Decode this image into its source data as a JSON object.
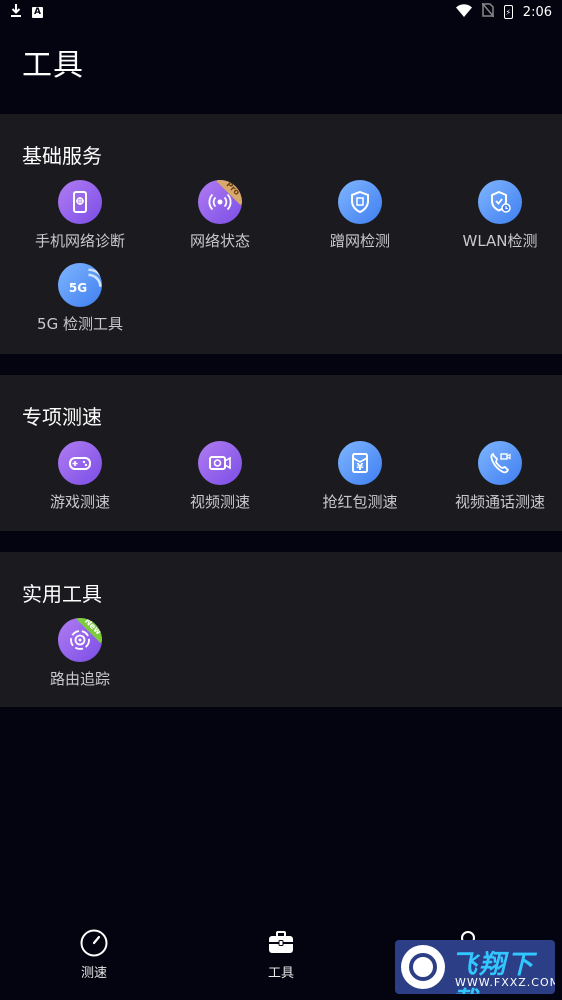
{
  "status_bar": {
    "time": "2:06",
    "battery_glyph": "⚡",
    "notification_badge": "A"
  },
  "page": {
    "title": "工具"
  },
  "sections": [
    {
      "title": "基础服务",
      "items": [
        {
          "label": "手机网络诊断",
          "icon": "phone-network-icon",
          "color": "purple"
        },
        {
          "label": "网络状态",
          "icon": "network-status-icon",
          "color": "purple",
          "tag": "Pro"
        },
        {
          "label": "蹭网检测",
          "icon": "shield-detect-icon",
          "color": "blue"
        },
        {
          "label": "WLAN检测",
          "icon": "wlan-shield-icon",
          "color": "blue"
        },
        {
          "label": "5G 检测工具",
          "icon": "5g-icon",
          "color": "blue",
          "icon_text": "5G"
        }
      ]
    },
    {
      "title": "专项测速",
      "items": [
        {
          "label": "游戏测速",
          "icon": "gamepad-icon",
          "color": "purple"
        },
        {
          "label": "视频测速",
          "icon": "video-camera-icon",
          "color": "purple"
        },
        {
          "label": "抢红包测速",
          "icon": "red-envelope-icon",
          "color": "blue",
          "icon_text": "¥"
        },
        {
          "label": "视频通话测速",
          "icon": "video-call-icon",
          "color": "blue"
        }
      ]
    },
    {
      "title": "实用工具",
      "items": [
        {
          "label": "路由追踪",
          "icon": "route-trace-icon",
          "color": "purple",
          "tag": "New"
        }
      ]
    }
  ],
  "bottom_nav": [
    {
      "label": "测速",
      "icon": "speedometer-icon"
    },
    {
      "label": "工具",
      "icon": "toolbox-icon",
      "active": true
    },
    {
      "label": "",
      "icon": "profile-icon"
    }
  ],
  "watermark": {
    "text": "飞翔下载",
    "url": "WWW.FXXZ.COM"
  }
}
